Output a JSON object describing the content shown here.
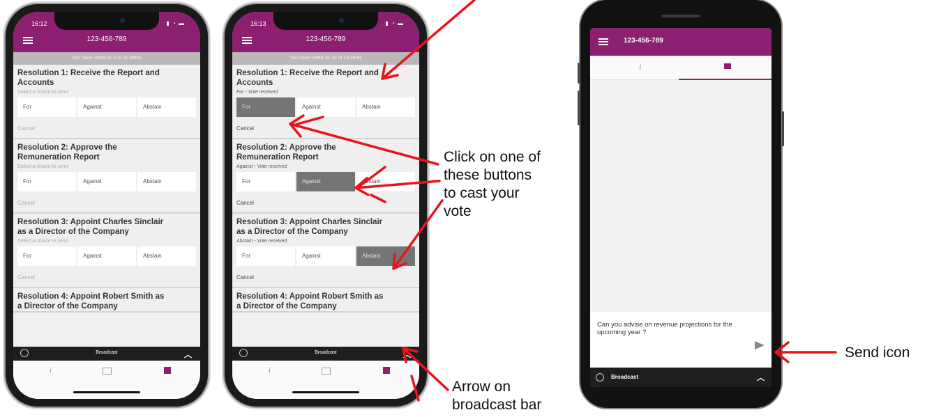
{
  "phone1": {
    "time": "16:12",
    "status_icons": "▮ ◔ ▬",
    "title": "123-456-789",
    "progress": "You have voted on 0 of 10 items",
    "resolutions": [
      {
        "title": "Resolution 1: Receive the Report and Accounts",
        "sub": "Select a choice to send",
        "choices": [
          "For",
          "Against",
          "Abstain"
        ],
        "selected": null,
        "cancel": "Cancel"
      },
      {
        "title": "Resolution 2: Approve the Remuneration Report",
        "sub": "Select a choice to send",
        "choices": [
          "For",
          "Against",
          "Abstain"
        ],
        "selected": null,
        "cancel": "Cancel"
      },
      {
        "title": "Resolution 3: Appoint Charles Sinclair as a Director of the Company",
        "sub": "Select a choice to send",
        "choices": [
          "For",
          "Against",
          "Abstain"
        ],
        "selected": null,
        "cancel": "Cancel"
      },
      {
        "title": "Resolution 4: Appoint Robert Smith as a Director of the Company"
      }
    ],
    "broadcast": "Broadcast"
  },
  "phone2": {
    "time": "16:13",
    "status_icons": "▮ ◔ ▬",
    "title": "123-456-789",
    "progress": "You have voted on 10 of 10 items",
    "resolutions": [
      {
        "title": "Resolution 1: Receive the Report and Accounts",
        "sub": "For - Vote received",
        "choices": [
          "For",
          "Against",
          "Abstain"
        ],
        "selected": 0,
        "cancel": "Cancel"
      },
      {
        "title": "Resolution 2: Approve the Remuneration Report",
        "sub": "Against - Vote received",
        "choices": [
          "For",
          "Against",
          "Abstain"
        ],
        "selected": 1,
        "cancel": "Cancel"
      },
      {
        "title": "Resolution 3: Appoint Charles Sinclair as a Director of the Company",
        "sub": "Abstain - Vote received",
        "choices": [
          "For",
          "Against",
          "Abstain"
        ],
        "selected": 2,
        "cancel": "Cancel"
      },
      {
        "title": "Resolution 4: Appoint Robert Smith as a Director of the Company"
      }
    ],
    "broadcast": "Broadcast"
  },
  "phone3": {
    "title": "123-456-789",
    "message": "Can you advise on revenue projections for the upcoming year ?",
    "broadcast": "Broadcast"
  },
  "callouts": {
    "buttons": [
      "Click on one of",
      "these buttons",
      "to cast your",
      "vote"
    ],
    "send": "Send icon",
    "arrow": [
      "Arrow on",
      "broadcast bar"
    ]
  },
  "colors": {
    "brand": "#8c1f70",
    "selected_choice": "#757575",
    "arrow": "#e8141c"
  }
}
